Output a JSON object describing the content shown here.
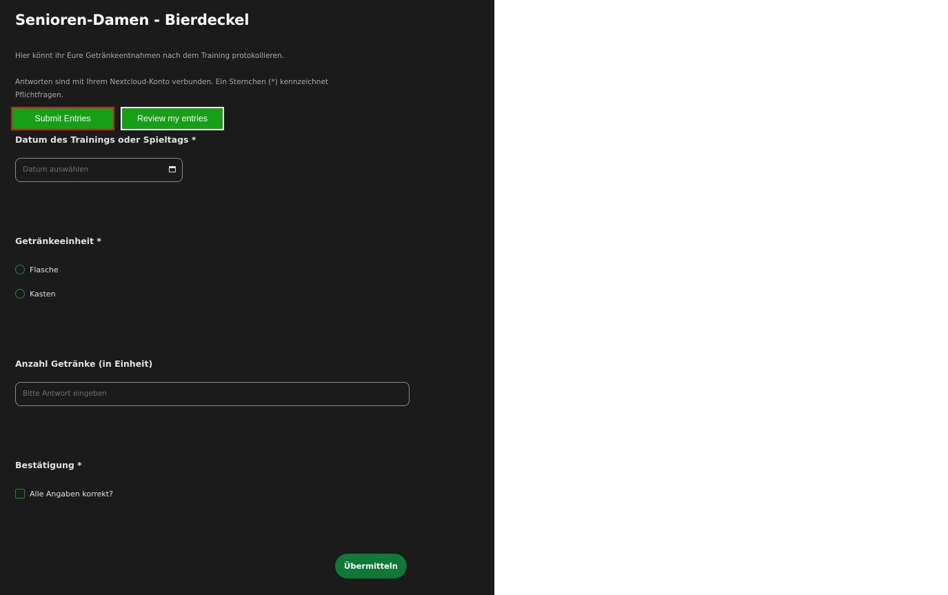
{
  "form": {
    "title": "Senioren-Damen - Bierdeckel",
    "description": "Hier könnt ihr Eure Getränkeentnahmen nach dem Training protokollieren.",
    "account_notice": "Antworten sind mit Ihrem Nextcloud-Konto verbunden. Ein Sternchen (*) kennzeichnet Pflichtfragen."
  },
  "actions": {
    "submit_entries_label": "Submit Entries",
    "review_entries_label": "Review my entries"
  },
  "questions": {
    "date": {
      "label": "Datum des Trainings oder Spieltags *",
      "placeholder": "Datum auswählen",
      "icon": "calendar-icon"
    },
    "unit": {
      "label": "Getränkeeinheit *",
      "options": [
        {
          "label": "Flasche",
          "selected": false
        },
        {
          "label": "Kasten",
          "selected": false
        }
      ]
    },
    "count": {
      "label": "Anzahl Getränke (in Einheit)",
      "placeholder": "Bitte Antwort eingeben"
    },
    "confirm": {
      "label": "Bestätigung *",
      "checkbox_label": "Alle Angaben korrekt?",
      "checked": false
    }
  },
  "submit": {
    "label": "Übermitteln"
  },
  "colors": {
    "panel_background": "#1b1b1b",
    "button_green": "#16a016",
    "accent_green": "#0e7a36",
    "highlight_red": "#cc1a1a"
  }
}
